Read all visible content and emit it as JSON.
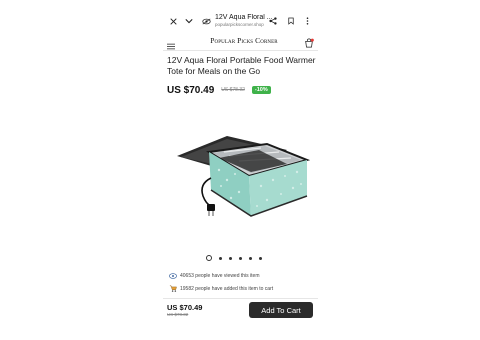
{
  "browser": {
    "tab_title": "12V Aqua Floral ...",
    "tab_url": "popularpickscorner.shop"
  },
  "site": {
    "logo": "Popular Picks Corner"
  },
  "product": {
    "title": "12V Aqua Floral Portable Food Warmer Tote for Meals on the Go",
    "price": "US $70.49",
    "old_price": "US $78.32",
    "discount": "-10%",
    "image_count": 6,
    "active_image": 1
  },
  "stats": {
    "viewed": "40653 people have viewed this item",
    "added": "19582 people have added this item to cart"
  },
  "bottom_bar": {
    "price": "US $70.49",
    "old_price": "US $78.32",
    "cart_label": "Add To Cart"
  },
  "colors": {
    "discount_badge": "#3fb24a",
    "cart_button": "#2b2b2b",
    "product_aqua": "#9fd6c9"
  }
}
